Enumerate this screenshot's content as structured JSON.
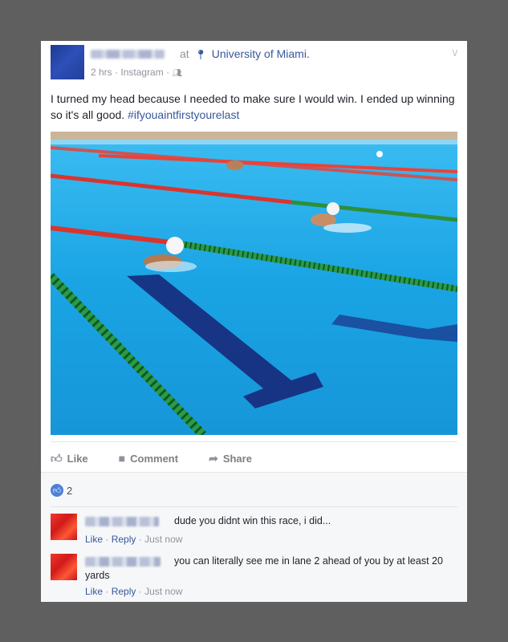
{
  "post": {
    "at_prefix": "at",
    "location": "University of Miami.",
    "time": "2 hrs",
    "source": "Instagram",
    "audience_icon": "friends-icon",
    "status_text": "I turned my head because I needed to make sure I would win. I ended up winning so it's all good. ",
    "hashtag": "#ifyouaintfirstyourelast",
    "photo_description_icon": "swimming-pool-photo"
  },
  "actions": {
    "like": "Like",
    "comment": "Comment",
    "share": "Share"
  },
  "reactions": {
    "count": "2"
  },
  "comments": [
    {
      "text": "dude you didnt win this race, i did...",
      "like": "Like",
      "reply": "Reply",
      "time": "Just now"
    },
    {
      "text": "you can literally see me in lane 2 ahead of you by at least 20 yards",
      "like": "Like",
      "reply": "Reply",
      "time": "Just now"
    }
  ],
  "colors": {
    "link": "#365899",
    "meta": "#90949c",
    "background": "#5f5f5f",
    "pool": "#1fa8e6"
  }
}
